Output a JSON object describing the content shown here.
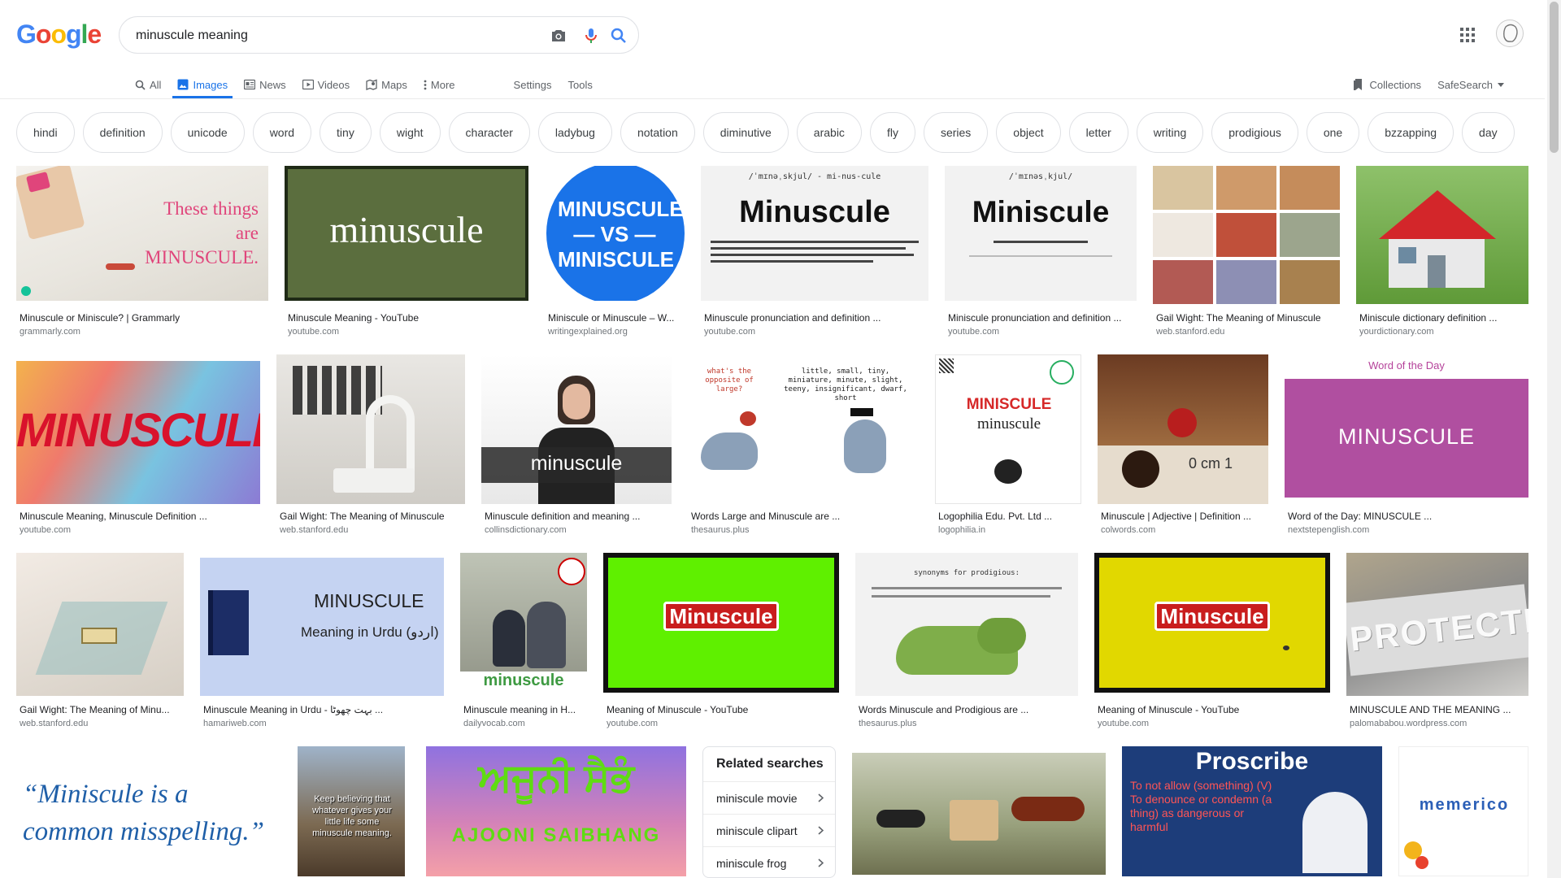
{
  "logo": {
    "letters": [
      "G",
      "o",
      "o",
      "g",
      "l",
      "e"
    ],
    "colors": [
      "#4285F4",
      "#EA4335",
      "#FBBC05",
      "#4285F4",
      "#34A853",
      "#EA4335"
    ]
  },
  "search": {
    "query": "minuscule meaning"
  },
  "nav": {
    "tabs": [
      {
        "label": "All",
        "icon": "search-icon"
      },
      {
        "label": "Images",
        "icon": "image-icon"
      },
      {
        "label": "News",
        "icon": "news-icon"
      },
      {
        "label": "Videos",
        "icon": "video-icon"
      },
      {
        "label": "Maps",
        "icon": "map-pin-icon"
      },
      {
        "label": "More",
        "icon": "more-vert-icon"
      }
    ],
    "settings": "Settings",
    "tools": "Tools",
    "collections": "Collections",
    "safesearch": "SafeSearch"
  },
  "chips": [
    "hindi",
    "definition",
    "unicode",
    "word",
    "tiny",
    "wight",
    "character",
    "ladybug",
    "notation",
    "diminutive",
    "arabic",
    "fly",
    "series",
    "object",
    "letter",
    "writing",
    "prodigious",
    "one",
    "bzzapping",
    "day"
  ],
  "results": [
    {
      "caption": "Minuscule or Miniscule? | Grammarly",
      "source": "grammarly.com",
      "overlay": "These things are MINUSCULE."
    },
    {
      "caption": "Minuscule Meaning - YouTube",
      "source": "youtube.com",
      "overlay": "minuscule"
    },
    {
      "caption": "Miniscule or Minuscule – W...",
      "source": "writingexplained.org",
      "overlay": "MINUSCULE — VS — MINISCULE"
    },
    {
      "caption": "Minuscule pronunciation and definition ...",
      "source": "youtube.com",
      "overlay": "Minuscule",
      "phonetic": "/ˈmɪnəˌskjul/ - mi-nus-cule"
    },
    {
      "caption": "Miniscule pronunciation and definition ...",
      "source": "youtube.com",
      "overlay": "Miniscule",
      "phonetic": "/ˈmɪnəsˌkjul/"
    },
    {
      "caption": "Gail Wight: The Meaning of Minuscule",
      "source": "web.stanford.edu"
    },
    {
      "caption": "Miniscule dictionary definition ...",
      "source": "yourdictionary.com"
    },
    {
      "caption": "Minuscule Meaning, Minuscule Definition ...",
      "source": "youtube.com",
      "overlay": "MINUSCULE"
    },
    {
      "caption": "Gail Wight: The Meaning of Minuscule",
      "source": "web.stanford.edu"
    },
    {
      "caption": "Minuscule definition and meaning ...",
      "source": "collinsdictionary.com",
      "overlay": "minuscule"
    },
    {
      "caption": "Words Large and Minuscule are ...",
      "source": "thesaurus.plus",
      "overlay": "little, small, tiny, miniature, minute, slight, teeny, insignificant, dwarf, short",
      "overlay2": "what's the opposite of large?"
    },
    {
      "caption": "Logophilia Edu. Pvt. Ltd ...",
      "source": "logophilia.in",
      "overlay": "MINISCULE",
      "overlay2": "minuscule"
    },
    {
      "caption": "Minuscule | Adjective | Definition ...",
      "source": "colwords.com",
      "overlay": "0 cm 1"
    },
    {
      "caption": "Word of the Day: MINUSCULE ...",
      "source": "nextstepenglish.com",
      "overlay": "MINUSCULE",
      "overlay2": "Word of the Day"
    },
    {
      "caption": "Gail Wight: The Meaning of Minu...",
      "source": "web.stanford.edu"
    },
    {
      "caption": "Minuscule Meaning in Urdu - بہت چھوٹا ...",
      "source": "hamariweb.com",
      "overlay": "MINUSCULE",
      "overlay2": "Meaning in Urdu (اردو)"
    },
    {
      "caption": "Minuscule meaning in H...",
      "source": "dailyvocab.com",
      "overlay": "minuscule"
    },
    {
      "caption": "Meaning of Minuscule - YouTube",
      "source": "youtube.com",
      "overlay": "Minuscule"
    },
    {
      "caption": "Words Minuscule and Prodigious are ...",
      "source": "thesaurus.plus",
      "overlay": "synonyms for prodigious:"
    },
    {
      "caption": "Meaning of Minuscule - YouTube",
      "source": "youtube.com",
      "overlay": "Minuscule"
    },
    {
      "caption": "MINUSCULE AND THE MEANING ...",
      "source": "palomababou.wordpress.com",
      "overlay": "PROTECTE"
    },
    {
      "overlay": "“Miniscule is a common misspelling.”"
    },
    {
      "overlay": "Keep believing that whatever gives your little life some minuscule meaning."
    },
    {
      "overlay": "ਅਜੂਨੀ ਸੈਭੰ",
      "overlay2": "AJOONI SAIBHANG"
    },
    {},
    {
      "overlay": "Proscribe",
      "overlay2": "To not allow (something) (V) To denounce or condemn (a thing) as dangerous or harmful"
    },
    {
      "overlay": "memerico"
    }
  ],
  "related": {
    "title": "Related searches",
    "items": [
      "miniscule movie",
      "miniscule clipart",
      "miniscule frog"
    ]
  }
}
